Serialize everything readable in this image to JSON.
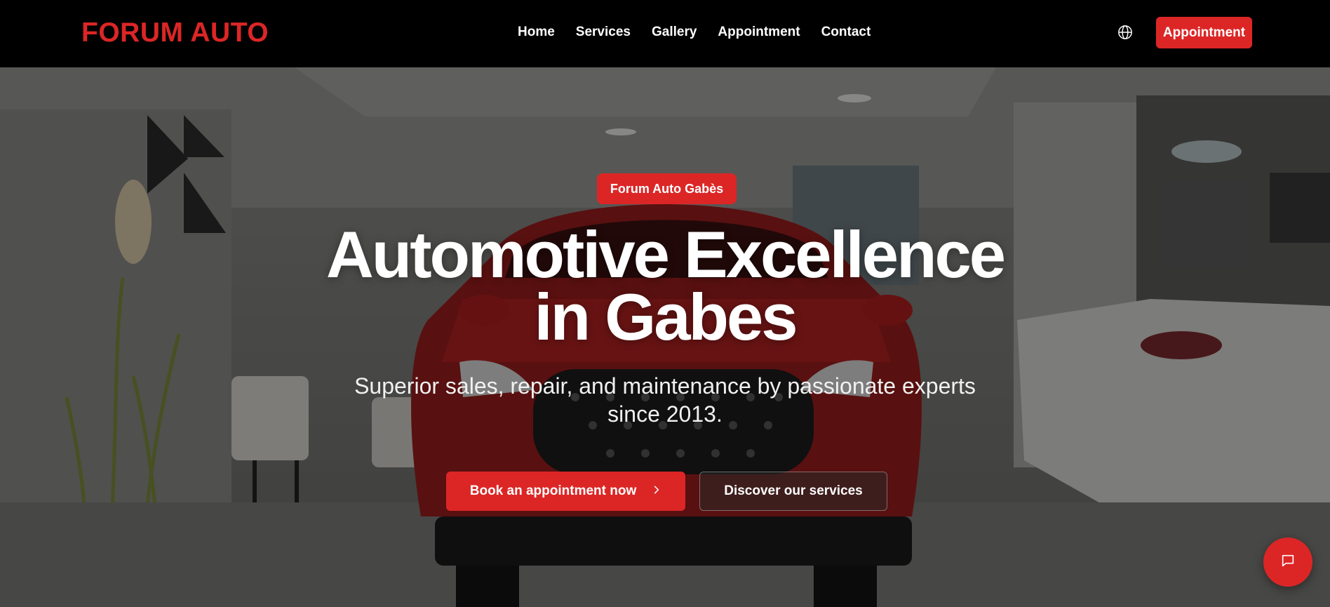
{
  "brand": {
    "name": "FORUM AUTO",
    "accent_color": "#dc2626"
  },
  "nav": {
    "items": [
      {
        "label": "Home"
      },
      {
        "label": "Services"
      },
      {
        "label": "Gallery"
      },
      {
        "label": "Appointment"
      },
      {
        "label": "Contact"
      }
    ],
    "language_icon": "globe-icon",
    "cta_label": "Appointment"
  },
  "hero": {
    "badge": "Forum Auto Gabès",
    "headline_line1": "Automotive Excellence",
    "headline_line2": "in Gabes",
    "subheadline": "Superior sales, repair, and maintenance by passionate experts since 2013.",
    "primary_cta": "Book an appointment now",
    "primary_cta_icon": "chevron-right-icon",
    "secondary_cta": "Discover our services",
    "background_image": "showroom with red SUV"
  },
  "chat": {
    "icon": "chat-bubble-icon"
  }
}
